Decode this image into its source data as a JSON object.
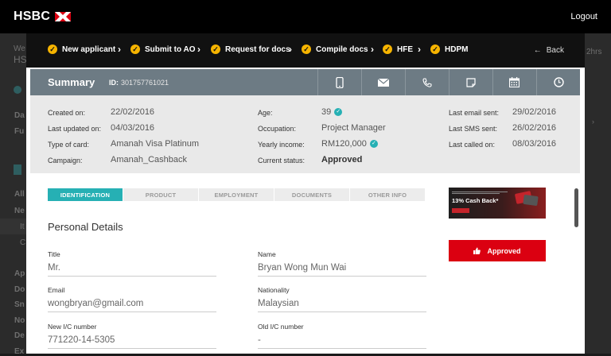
{
  "header": {
    "brand": "HSBC",
    "logout": "Logout"
  },
  "background": {
    "we": "We",
    "hs": "HS",
    "hrs": "2hrs",
    "da": "Da",
    "fu": "Fu",
    "all": "All",
    "ne": "Ne",
    "it": "It",
    "c": "C",
    "ap": "Ap",
    "do": "Do",
    "sn": "Sn",
    "ino": "No",
    "de": "De",
    "ex": "Ex"
  },
  "steps": [
    "New applicant",
    "Submit to AO",
    "Request for docs",
    "Compile docs",
    "HFE",
    "HDPM"
  ],
  "back_label": "Back",
  "summary": {
    "title": "Summary",
    "id_label": "ID:",
    "id_value": "301757761021",
    "icons": [
      "mobile-icon",
      "mail-icon",
      "phone-icon",
      "note-icon",
      "calendar-icon",
      "clock-icon"
    ]
  },
  "details": {
    "created_on_label": "Created on:",
    "created_on": "22/02/2016",
    "last_updated_label": "Last updated on:",
    "last_updated": "04/03/2016",
    "card_type_label": "Type of card:",
    "card_type": "Amanah Visa Platinum",
    "campaign_label": "Campaign:",
    "campaign": "Amanah_Cashback",
    "age_label": "Age:",
    "age": "39",
    "occupation_label": "Occupation:",
    "occupation": "Project Manager",
    "income_label": "Yearly income:",
    "income": "RM120,000",
    "status_label": "Current status:",
    "status": "Approved",
    "last_email_label": "Last email sent:",
    "last_email": "29/02/2016",
    "last_sms_label": "Last SMS sent:",
    "last_sms": "26/02/2016",
    "last_called_label": "Last called on:",
    "last_called": "08/03/2016"
  },
  "tabs": [
    "IDENTIFICATION",
    "PRODUCT",
    "EMPLOYMENT",
    "DOCUMENTS",
    "OTHER INFO"
  ],
  "personal": {
    "section_title": "Personal Details",
    "title_label": "Title",
    "title_value": "Mr.",
    "name_label": "Name",
    "name_value": "Bryan Wong Mun Wai",
    "email_label": "Email",
    "email_value": "wongbryan@gmail.com",
    "nationality_label": "Nationality",
    "nationality_value": "Malaysian",
    "new_ic_label": "New I/C number",
    "new_ic_value": "771220-14-5305",
    "old_ic_label": "Old I/C number",
    "old_ic_value": "-"
  },
  "ad": {
    "headline": "13% Cash Back*"
  },
  "approved_button": "Approved",
  "colors": {
    "accent_teal": "#26b0b4",
    "brand_red": "#db0011",
    "step_check": "#f6b400",
    "summary_bar": "#6d7b84"
  }
}
